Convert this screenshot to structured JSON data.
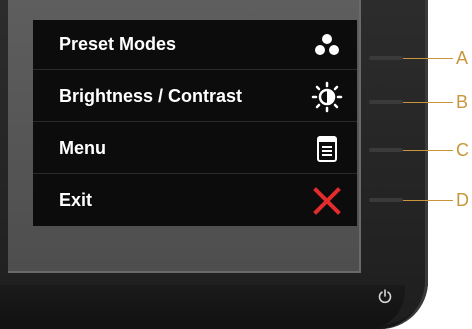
{
  "osd": {
    "items": [
      {
        "label": "Preset Modes",
        "icon": "preset-modes-icon"
      },
      {
        "label": "Brightness / Contrast",
        "icon": "brightness-contrast-icon"
      },
      {
        "label": "Menu",
        "icon": "menu-icon"
      },
      {
        "label": "Exit",
        "icon": "exit-icon"
      }
    ]
  },
  "buttons": {
    "callouts": [
      "A",
      "B",
      "C",
      "D"
    ]
  },
  "colors": {
    "osd_background": "#0c0c0c",
    "osd_text": "#ffffff",
    "exit_icon": "#e42c2c",
    "callout": "#c8963c",
    "bezel": "#262626"
  }
}
